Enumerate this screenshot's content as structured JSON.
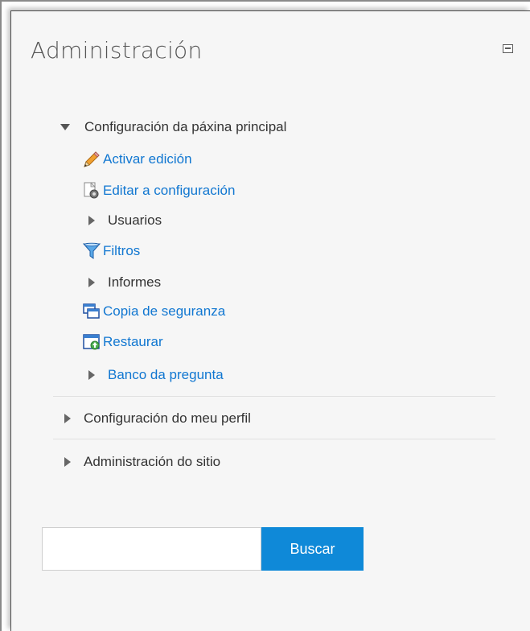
{
  "block": {
    "title": "Administración",
    "collapse_icon": "collapse-icon"
  },
  "nav": {
    "front_page_settings": "Configuración da páxina principal",
    "turn_editing_on": "Activar edición",
    "edit_settings": "Editar a configuración",
    "users": "Usuarios",
    "filters": "Filtros",
    "reports": "Informes",
    "backup": "Copia de seguranza",
    "restore": "Restaurar",
    "question_bank": "Banco da pregunta",
    "my_profile_settings": "Configuración do meu perfil",
    "site_administration": "Administración do sitio"
  },
  "search": {
    "value": "",
    "button_label": "Buscar"
  },
  "colors": {
    "link": "#1177d1",
    "button": "#0f89d8",
    "text": "#333333"
  }
}
